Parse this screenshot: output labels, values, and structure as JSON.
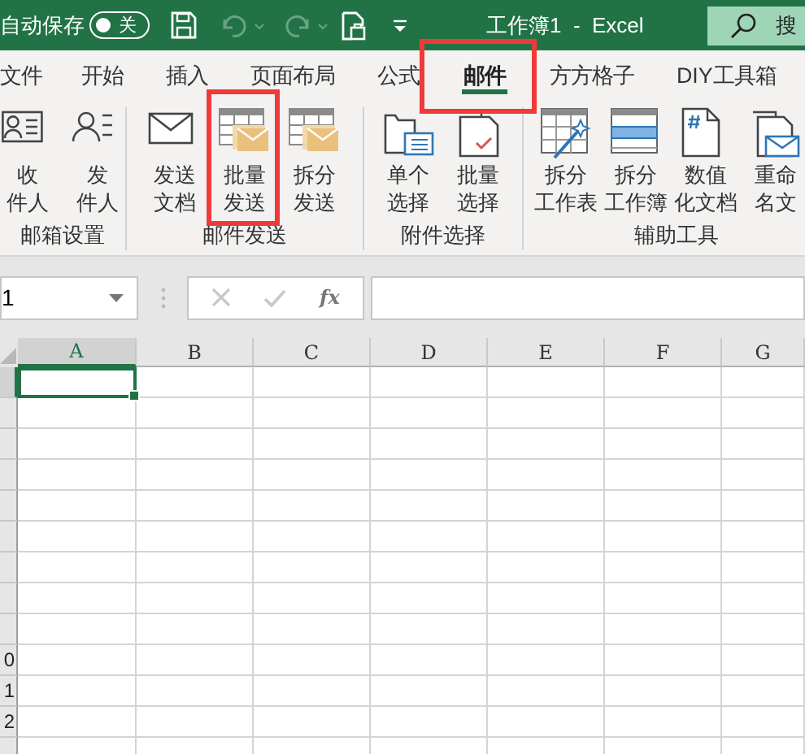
{
  "title_bar": {
    "autosave_label": "自动保存",
    "autosave": {
      "on": false,
      "label": "关"
    },
    "title": "工作簿1  -  Excel",
    "search_label": "搜"
  },
  "tabs": [
    {
      "label": "文件",
      "selected": false,
      "highlighted": false
    },
    {
      "label": "开始",
      "selected": false,
      "highlighted": false
    },
    {
      "label": "插入",
      "selected": false,
      "highlighted": false
    },
    {
      "label": "页面布局",
      "selected": false,
      "highlighted": false
    },
    {
      "label": "公式",
      "selected": false,
      "highlighted": false
    },
    {
      "label": "邮件",
      "selected": true,
      "highlighted": true
    },
    {
      "label": "方方格子",
      "selected": false,
      "highlighted": false
    },
    {
      "label": "DIY工具箱",
      "selected": false,
      "highlighted": false
    }
  ],
  "ribbon_groups": [
    {
      "label": "邮箱设置",
      "buttons": [
        {
          "lines": [
            "收",
            "件人"
          ],
          "kind": "person-card",
          "highlighted": false
        },
        {
          "lines": [
            "发",
            "件人"
          ],
          "kind": "person-list",
          "highlighted": false
        }
      ]
    },
    {
      "label": "邮件发送",
      "buttons": [
        {
          "lines": [
            "发送",
            "文档"
          ],
          "kind": "envelope",
          "highlighted": false
        },
        {
          "lines": [
            "批量",
            "发送"
          ],
          "kind": "table-mail",
          "highlighted": true
        },
        {
          "lines": [
            "拆分",
            "发送"
          ],
          "kind": "table-mail",
          "highlighted": false
        }
      ]
    },
    {
      "label": "附件选择",
      "buttons": [
        {
          "lines": [
            "单个",
            "选择"
          ],
          "kind": "doc-list",
          "highlighted": false
        },
        {
          "lines": [
            "批量",
            "选择"
          ],
          "kind": "docs-check",
          "highlighted": false
        }
      ]
    },
    {
      "label": "辅助工具",
      "buttons": [
        {
          "lines": [
            "拆分",
            "工作表"
          ],
          "kind": "table-wand",
          "highlighted": false
        },
        {
          "lines": [
            "拆分",
            "工作簿"
          ],
          "kind": "table-band",
          "highlighted": false
        },
        {
          "lines": [
            "数值",
            "化文档"
          ],
          "kind": "doc-hash",
          "highlighted": false
        },
        {
          "lines": [
            "重命",
            "名文"
          ],
          "kind": "docs-mail",
          "highlighted": false
        }
      ]
    }
  ],
  "formula_bar": {
    "name_box": "1",
    "function_label": "fx"
  },
  "sheet": {
    "columns": [
      {
        "label": "A",
        "selected": true
      },
      {
        "label": "B",
        "selected": false
      },
      {
        "label": "C",
        "selected": false
      },
      {
        "label": "D",
        "selected": false
      },
      {
        "label": "E",
        "selected": false
      },
      {
        "label": "F",
        "selected": false
      },
      {
        "label": "G",
        "selected": false
      }
    ],
    "rows": [
      {
        "selected": true
      },
      {
        "selected": false
      },
      {
        "selected": false
      },
      {
        "selected": false
      },
      {
        "selected": false
      },
      {
        "selected": false
      },
      {
        "selected": false
      },
      {
        "selected": false
      },
      {
        "selected": false
      },
      {
        "selected": false,
        "label": "0"
      },
      {
        "selected": false,
        "label": "1"
      },
      {
        "selected": false,
        "label": "2"
      },
      {
        "selected": false
      }
    ]
  }
}
